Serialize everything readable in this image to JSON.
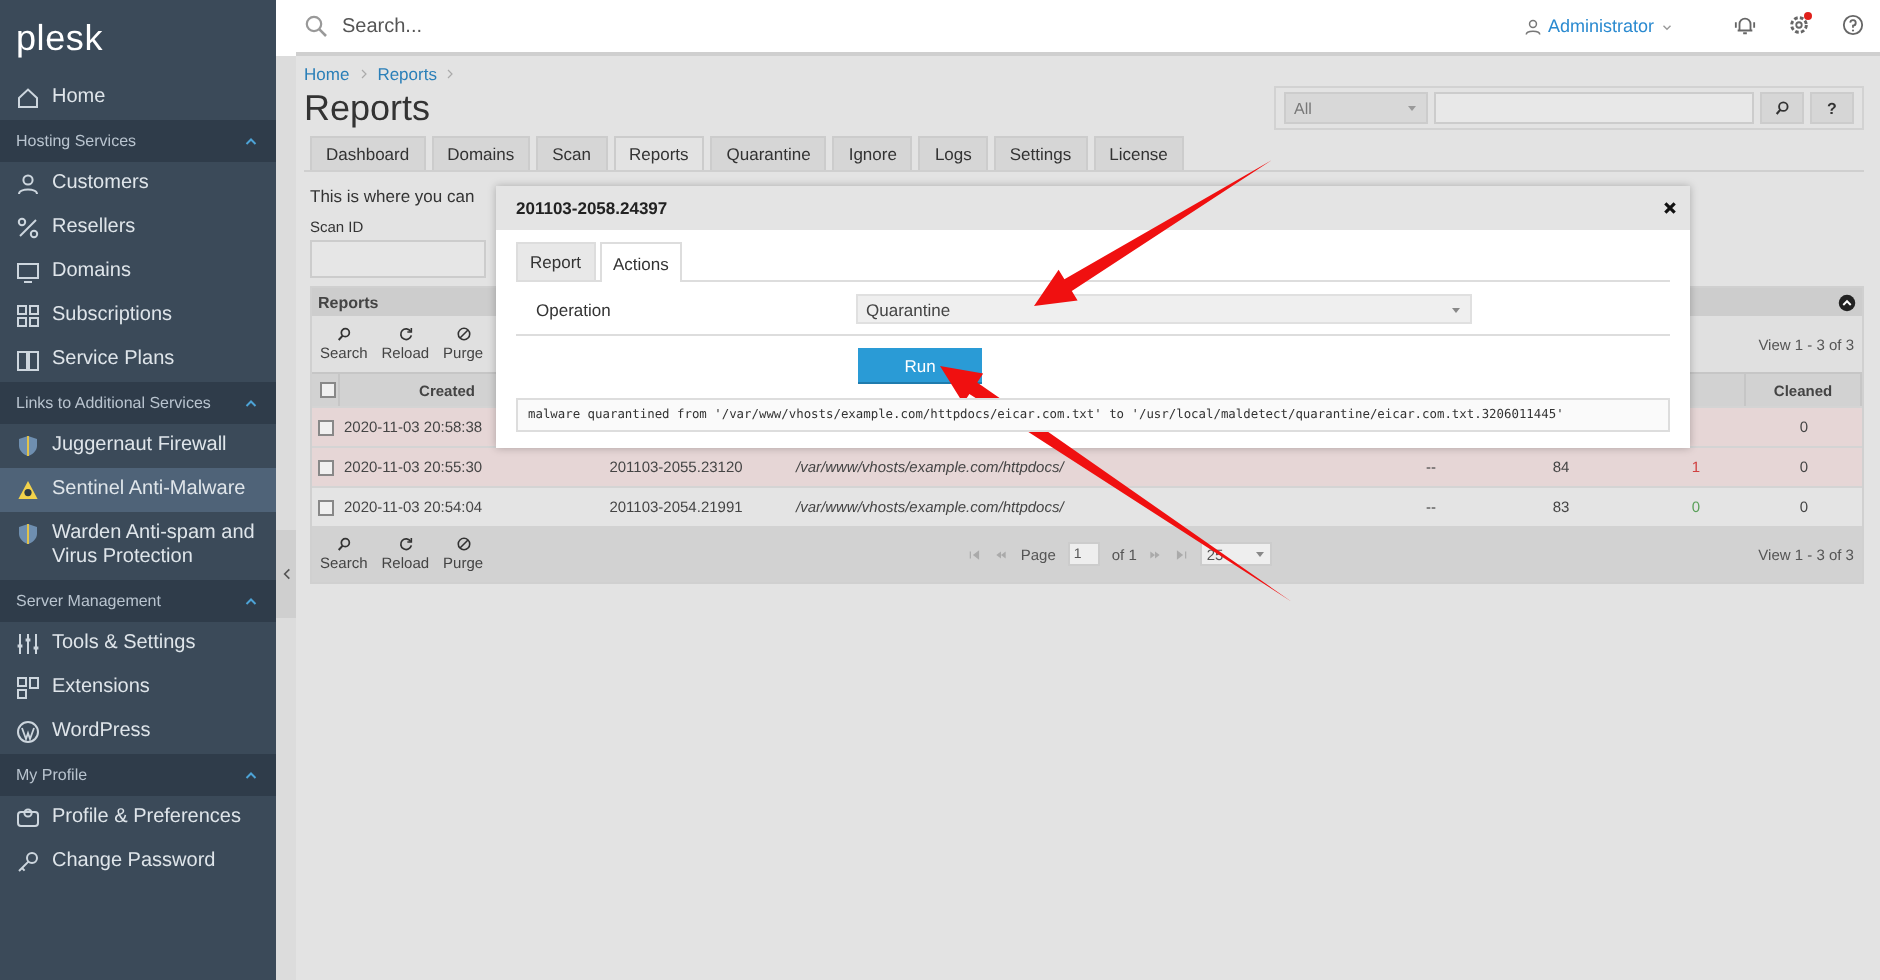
{
  "sidebar": {
    "logo": "plesk",
    "items": [
      {
        "kind": "item",
        "label": "Home",
        "selected": false
      },
      {
        "kind": "section",
        "label": "Hosting Services",
        "expanded": true
      },
      {
        "kind": "item",
        "label": "Customers",
        "selected": false
      },
      {
        "kind": "item",
        "label": "Resellers",
        "selected": false
      },
      {
        "kind": "item",
        "label": "Domains",
        "selected": false
      },
      {
        "kind": "item",
        "label": "Subscriptions",
        "selected": false
      },
      {
        "kind": "item",
        "label": "Service Plans",
        "selected": false
      },
      {
        "kind": "section",
        "label": "Links to Additional Services",
        "expanded": true
      },
      {
        "kind": "item",
        "label": "Juggernaut Firewall",
        "selected": false
      },
      {
        "kind": "item",
        "label": "Sentinel Anti-Malware",
        "selected": true
      },
      {
        "kind": "item",
        "label": "Warden Anti-spam and Virus Protection",
        "selected": false
      },
      {
        "kind": "section",
        "label": "Server Management",
        "expanded": true
      },
      {
        "kind": "item",
        "label": "Tools & Settings",
        "selected": false
      },
      {
        "kind": "item",
        "label": "Extensions",
        "selected": false
      },
      {
        "kind": "item",
        "label": "WordPress",
        "selected": false
      },
      {
        "kind": "section",
        "label": "My Profile",
        "expanded": true
      },
      {
        "kind": "item",
        "label": "Profile & Preferences",
        "selected": false
      },
      {
        "kind": "item",
        "label": "Change Password",
        "selected": false
      }
    ]
  },
  "topbar": {
    "search": {
      "placeholder": "Search..."
    },
    "user": "Administrator",
    "notification": true
  },
  "breadcrumbs": [
    "Home",
    "Reports"
  ],
  "page_title": "Reports",
  "filter": {
    "select": "All",
    "help": "?"
  },
  "tabs": [
    {
      "label": "Dashboard",
      "selected": false
    },
    {
      "label": "Domains",
      "selected": false
    },
    {
      "label": "Scan",
      "selected": false
    },
    {
      "label": "Reports",
      "selected": true
    },
    {
      "label": "Quarantine",
      "selected": false
    },
    {
      "label": "Ignore",
      "selected": false
    },
    {
      "label": "Logs",
      "selected": false
    },
    {
      "label": "Settings",
      "selected": false
    },
    {
      "label": "License",
      "selected": false
    }
  ],
  "intro": "This is where you can",
  "scan_id": {
    "label": "Scan ID"
  },
  "reports": {
    "title": "Reports",
    "toolbar": [
      "Search",
      "Reload",
      "Purge"
    ],
    "view": "View 1 - 3 of 3",
    "select_all": {
      "checked": false
    },
    "columns": {
      "created": "Created",
      "cleaned": "Cleaned"
    },
    "rows": [
      {
        "flagged": true,
        "checked": false,
        "created": "2020-11-03 20:58:38",
        "cleaned": "0"
      },
      {
        "flagged": true,
        "checked": false,
        "created": "2020-11-03 20:55:30",
        "scan_id": "201103-2055.23120",
        "path": "/var/www/vhosts/example.com/httpdocs/",
        "column_4": "--",
        "column_5": "84",
        "column_6": "1",
        "cleaned": "0"
      },
      {
        "flagged": false,
        "checked": false,
        "created": "2020-11-03 20:54:04",
        "scan_id": "201103-2054.21991",
        "path": "/var/www/vhosts/example.com/httpdocs/",
        "column_4": "--",
        "column_5": "83",
        "column_6": "0",
        "cleaned": "0"
      }
    ],
    "footer_toolbar": [
      "Search",
      "Reload",
      "Purge"
    ],
    "pager": {
      "page_label": "Page",
      "page": "1",
      "of": "of 1",
      "per_page": "25"
    },
    "footer_view": "View 1 - 3 of 3"
  },
  "modal": {
    "title": "201103-2058.24397",
    "tabs": [
      {
        "label": "Report",
        "selected": false
      },
      {
        "label": "Actions",
        "selected": true
      }
    ],
    "operation": {
      "label": "Operation",
      "value": "Quarantine"
    },
    "run": "Run",
    "output": "malware quarantined from '/var/www/vhosts/example.com/httpdocs/eicar.com.txt' to '/usr/local/maldetect/quarantine/eicar.com.txt.3206011445'"
  }
}
